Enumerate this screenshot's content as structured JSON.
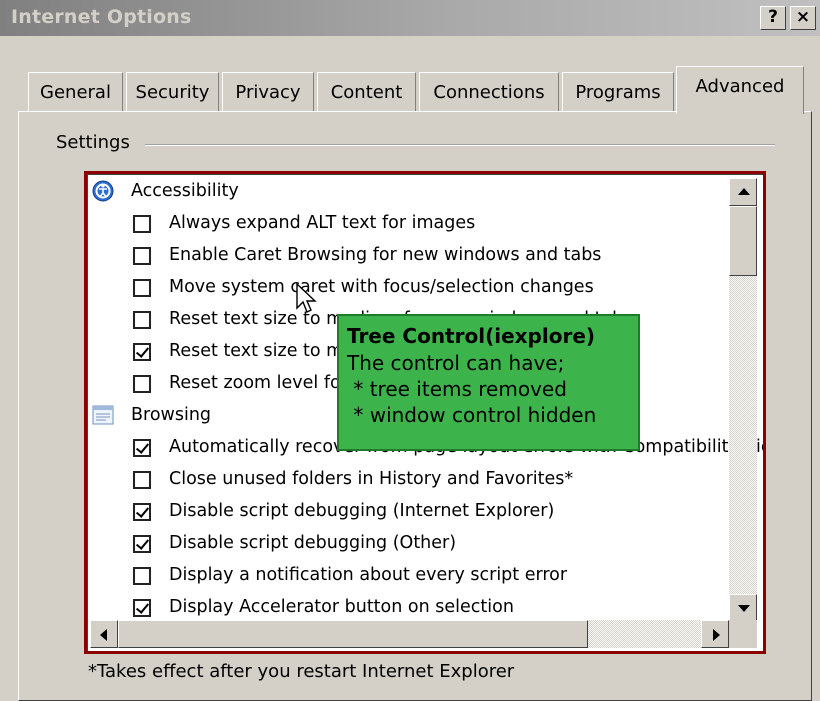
{
  "window": {
    "title": "Internet Options",
    "help_button": "?",
    "close_button": "×"
  },
  "tabs": [
    {
      "label": "General"
    },
    {
      "label": "Security"
    },
    {
      "label": "Privacy"
    },
    {
      "label": "Content"
    },
    {
      "label": "Connections"
    },
    {
      "label": "Programs"
    },
    {
      "label": "Advanced",
      "active": true
    }
  ],
  "settings_group": {
    "label": "Settings"
  },
  "tree": [
    {
      "kind": "category",
      "icon": "accessibility-icon",
      "label": "Accessibility"
    },
    {
      "kind": "item",
      "checked": false,
      "label": "Always expand ALT text for images"
    },
    {
      "kind": "item",
      "checked": false,
      "label": "Enable Caret Browsing for new windows and tabs"
    },
    {
      "kind": "item",
      "checked": false,
      "label": "Move system caret with focus/selection changes"
    },
    {
      "kind": "item",
      "checked": false,
      "label": "Reset text size to medium for new windows and tabs"
    },
    {
      "kind": "item",
      "checked": true,
      "label": "Reset text size to medium while zooming*"
    },
    {
      "kind": "item",
      "checked": false,
      "label": "Reset zoom level for new windows and tabs"
    },
    {
      "kind": "category",
      "icon": "browsing-icon",
      "label": "Browsing"
    },
    {
      "kind": "item",
      "checked": true,
      "label": "Automatically recover from page layout errors with Compatibility View"
    },
    {
      "kind": "item",
      "checked": false,
      "label": "Close unused folders in History and Favorites*"
    },
    {
      "kind": "item",
      "checked": true,
      "label": "Disable script debugging (Internet Explorer)"
    },
    {
      "kind": "item",
      "checked": true,
      "label": "Disable script debugging (Other)"
    },
    {
      "kind": "item",
      "checked": false,
      "label": "Display a notification about every script error"
    },
    {
      "kind": "item",
      "checked": true,
      "label": "Display Accelerator button on selection"
    }
  ],
  "tooltip": {
    "title": "Tree Control(iexplore)",
    "lines": [
      "The control can have;",
      " * tree items removed",
      " * window control hidden"
    ],
    "color": "#3cb44b"
  },
  "footnote": "*Takes effect after you restart Internet Explorer",
  "colors": {
    "highlight_frame": "#8b0000",
    "titlebar": "#808080"
  }
}
